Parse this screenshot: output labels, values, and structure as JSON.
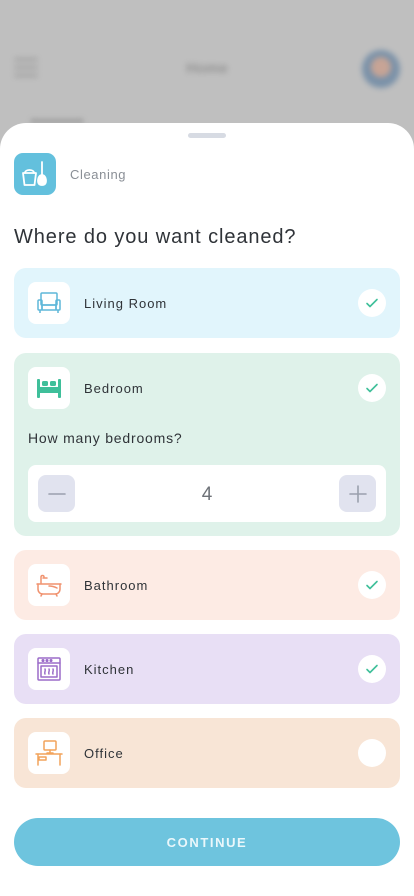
{
  "background": {
    "title": "Home",
    "icons": [
      "menu-icon",
      "avatar"
    ]
  },
  "service": {
    "label": "Cleaning",
    "icon": "cleaning-bucket-icon",
    "color": "#63c0dd"
  },
  "question": "Where do you want cleaned?",
  "rooms": [
    {
      "name": "Living Room",
      "icon": "armchair-icon",
      "selected": true,
      "color": "#e1f5fc"
    },
    {
      "name": "Bedroom",
      "icon": "bed-icon",
      "selected": true,
      "color": "#dff2ea"
    },
    {
      "name": "Bathroom",
      "icon": "bathtub-icon",
      "selected": true,
      "color": "#fdebe4"
    },
    {
      "name": "Kitchen",
      "icon": "oven-icon",
      "selected": true,
      "color": "#e8dff5"
    },
    {
      "name": "Office",
      "icon": "desk-icon",
      "selected": false,
      "color": "#f8e5d6"
    }
  ],
  "bedrooms": {
    "question": "How many bedrooms?",
    "count": "4"
  },
  "continue_label": "CONTINUE"
}
